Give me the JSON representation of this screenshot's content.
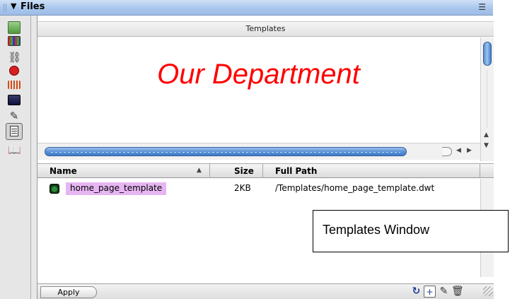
{
  "window": {
    "title": "Files",
    "collapse_icon": "triangle-down-icon",
    "options_icon": "options-menu-icon"
  },
  "sidebar": {
    "icons": [
      {
        "name": "images-icon"
      },
      {
        "name": "colors-icon"
      },
      {
        "name": "urls-icon"
      },
      {
        "name": "flash-icon"
      },
      {
        "name": "shockwave-icon"
      },
      {
        "name": "movies-icon"
      },
      {
        "name": "scripts-icon"
      },
      {
        "name": "templates-icon",
        "selected": true
      },
      {
        "name": "library-icon"
      }
    ]
  },
  "preview": {
    "header": "Templates",
    "text": "Our Department",
    "text_color": "#ff0000"
  },
  "table": {
    "columns": [
      "Name",
      "Size",
      "Full Path"
    ],
    "rows": [
      {
        "name": "home_page_template",
        "size": "2KB",
        "path": "/Templates/home_page_template.dwt"
      }
    ],
    "highlight_color": "#e6b6f2"
  },
  "footer": {
    "apply_label": "Apply",
    "icons": [
      "refresh-icon",
      "new-template-icon",
      "edit-icon",
      "delete-icon"
    ]
  },
  "callout": {
    "text": "Templates Window"
  }
}
